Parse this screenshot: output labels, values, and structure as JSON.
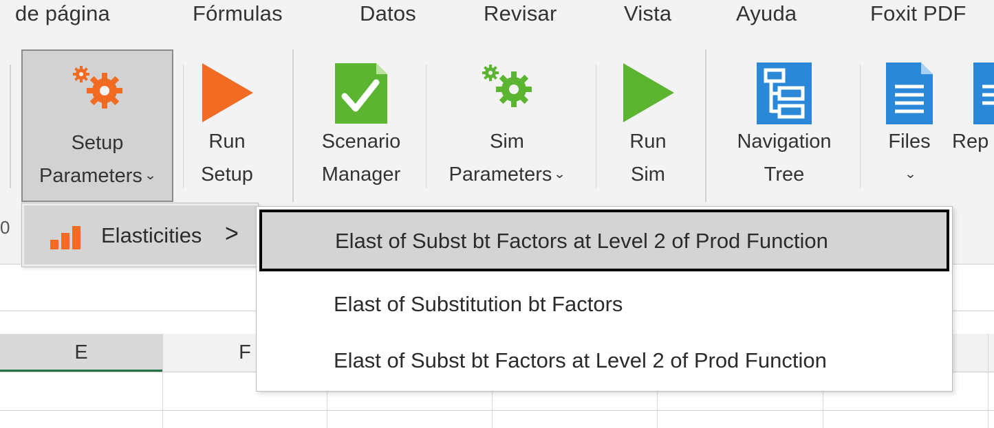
{
  "tabs": [
    "de página",
    "Fórmulas",
    "Datos",
    "Revisar",
    "Vista",
    "Ayuda",
    "Foxit PDF"
  ],
  "ribbon": {
    "setup_parameters": {
      "line1": "Setup",
      "line2": "Parameters",
      "chevron": "⌄",
      "icon": "gears-icon",
      "color": "#F26B22"
    },
    "run_setup": {
      "line1": "Run",
      "line2": "Setup",
      "icon": "play-icon",
      "color": "#F26B22"
    },
    "scenario_manager": {
      "line1": "Scenario",
      "line2": "Manager",
      "icon": "checkmark-document-icon",
      "color": "#5CB531"
    },
    "sim_parameters": {
      "line1": "Sim",
      "line2": "Parameters",
      "chevron": "⌄",
      "icon": "gears-icon",
      "color": "#5CB531"
    },
    "run_sim": {
      "line1": "Run",
      "line2": "Sim",
      "icon": "play-icon",
      "color": "#5CB531"
    },
    "navigation_tree": {
      "line1": "Navigation",
      "line2": "Tree",
      "icon": "tree-icon",
      "color": "#2B88D8"
    },
    "files": {
      "line1": "Files",
      "line2": "",
      "chevron": "⌄",
      "icon": "document-icon",
      "color": "#2B88D8"
    },
    "reports_partial": {
      "line1": "Rep",
      "line2": "",
      "icon": "document-icon",
      "color": "#2B88D8"
    },
    "group_label_partial": "0"
  },
  "grid": {
    "columns": [
      "E",
      "F"
    ],
    "active_column": "E",
    "accent": "#217346"
  },
  "menu_level1": {
    "items": [
      {
        "label": "Elasticities",
        "arrow": ">",
        "icon": "bar-chart-icon",
        "icon_color": "#F26B22"
      }
    ]
  },
  "menu_level2": {
    "items": [
      {
        "label": "Elast of Subst bt Factors at Level 2 of Prod Function",
        "highlighted": true
      },
      {
        "label": "Elast of Substitution bt Factors",
        "highlighted": false
      },
      {
        "label": "Elast of Subst bt Factors at Level 2 of Prod Function",
        "highlighted": false
      }
    ]
  }
}
